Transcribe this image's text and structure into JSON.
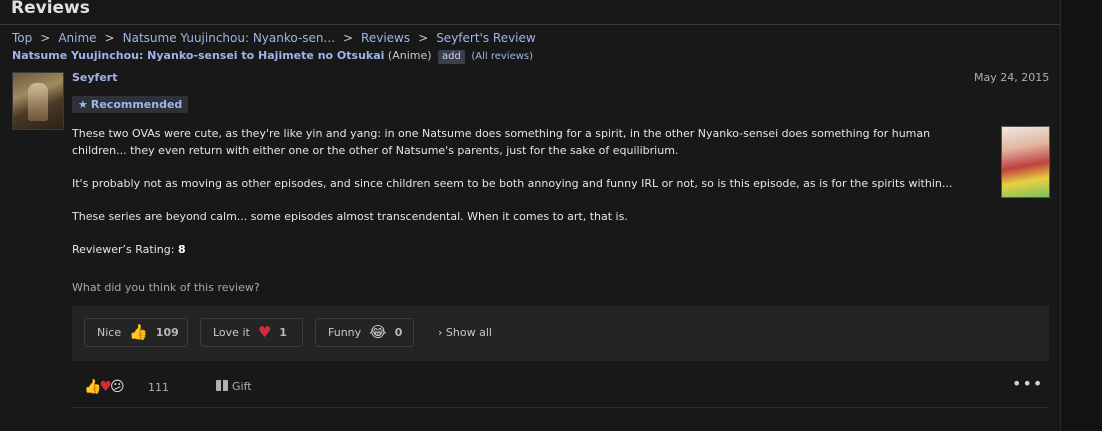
{
  "page": {
    "title": "Reviews"
  },
  "breadcrumb": {
    "items": [
      "Top",
      "Anime",
      "Natsume Yuujinchou: Nyanko-sen...",
      "Reviews",
      "Seyfert's Review"
    ],
    "separator": ">"
  },
  "anime": {
    "title": "Natsume Yuujinchou: Nyanko-sensei to Hajimete no Otsukai",
    "type": "(Anime)",
    "add_label": "add",
    "all_reviews_label": "(All reviews)"
  },
  "review": {
    "author": "Seyfert",
    "date": "May 24, 2015",
    "badge": "Recommended",
    "paragraphs": [
      "These two OVAs were cute, as they're like yin and yang: in one Natsume does something for a spirit, in the other Nyanko-sensei does something for human children... they even return with either one or the other of Natsume's parents, just for the sake of equilibrium.",
      "It's probably not as moving as other episodes, and since children seem to be both annoying and funny IRL or not, so is this episode, as is for the spirits within...",
      "These series are beyond calm... some episodes almost transcendental. When it comes to art, that is."
    ],
    "rating_label": "Reviewer’s Rating:",
    "rating_value": "8"
  },
  "feedback": {
    "question": "What did you think of this review?",
    "reactions": [
      {
        "label": "Nice",
        "icon": "thumbs-up-icon",
        "count": "109"
      },
      {
        "label": "Love it",
        "icon": "heart-icon",
        "count": "1"
      },
      {
        "label": "Funny",
        "icon": "laughing-face-icon",
        "count": "0"
      }
    ],
    "show_all_label": "Show all"
  },
  "footer": {
    "total_reactions": "111",
    "gift_label": "Gift"
  }
}
